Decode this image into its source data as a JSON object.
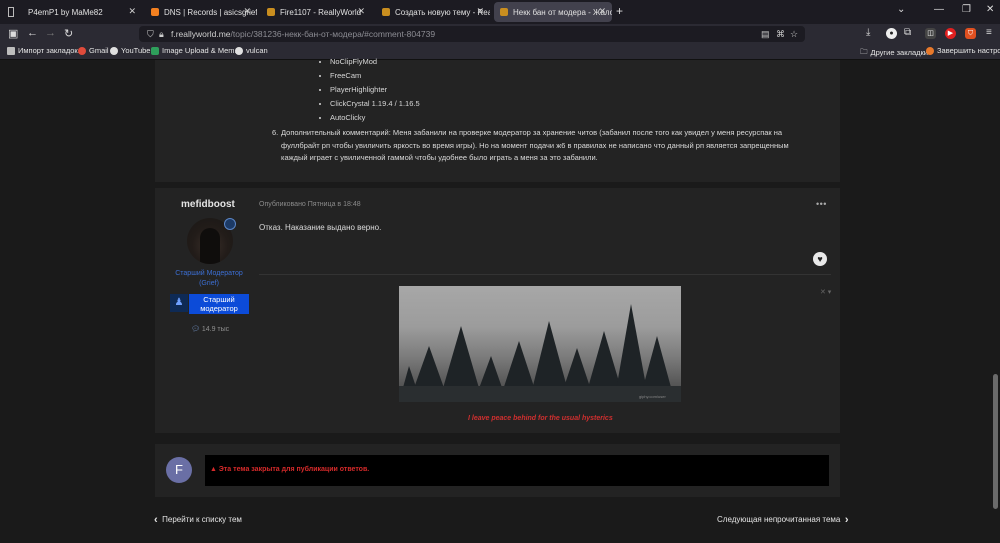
{
  "browser": {
    "tabs": [
      {
        "title": "P4emP1 by MaMe82",
        "fav": "#5d5d5d"
      },
      {
        "title": "DNS | Records | asicsgrief.onlin",
        "fav": "#f38020"
      },
      {
        "title": "Fire1107 - ReallyWorld",
        "fav": "#c98e1f"
      },
      {
        "title": "Создать новую тему - ReallyW",
        "fav": "#c98e1f"
      },
      {
        "title": "Некк бан от модера - Жалобы",
        "fav": "#c98e1f"
      }
    ],
    "url": {
      "host": "f.reallyworld.me",
      "path": "/topic/381236-некк-бан-от-модера/#comment-804739"
    },
    "bookmarks": [
      {
        "label": "Импорт закладок...",
        "color": "#bdbdbd"
      },
      {
        "label": "Gmail",
        "color": "#e04b3b"
      },
      {
        "label": "YouTube",
        "color": "#e0e0e0"
      },
      {
        "label": "Image Upload & Mem...",
        "color": "#2e9e5b"
      },
      {
        "label": "vulcan",
        "color": "#e0e0e0"
      }
    ],
    "other_bookmarks": "Другие закладки",
    "finish_setup": "Завершить настройку"
  },
  "post_top": {
    "bullets": [
      "NoClipFlyMod",
      "FreeCam",
      "PlayerHighlighter",
      "ClickCrystal 1.19.4 / 1.16.5",
      "AutoClicky"
    ],
    "item_number": "6.",
    "item_text": "Дополнительный комментарий: Меня забанили на проверке модератор за хранение читов (забанил после того как увидел у меня ресурспак на фуллбрайт рп чтобы увиличить яркость во время игры). Но на момент подачи ж6 в правилах не написано что данный рп является запрещенным каждый играет с увиличенной гаммой чтобы удобнее было играть а меня за это забанили."
  },
  "reply": {
    "author": "mefidboost",
    "role": "Старший Модератор (Grief)",
    "role_badge": "Старший модератор",
    "reputation": "14.9 тыс",
    "posted": "Опубликовано Пятница в 18:48",
    "body": "Отказ. Наказание выдано верно.",
    "menu": "•••",
    "signature": "I leave peace behind for the usual hysterics",
    "gif_watermark": "giphy.com/user"
  },
  "locked": {
    "avatar_letter": "F",
    "message": "Эта тема закрыта для публикации ответов."
  },
  "nav": {
    "prev": "Перейти к списку тем",
    "next": "Следующая непрочитанная тема"
  }
}
